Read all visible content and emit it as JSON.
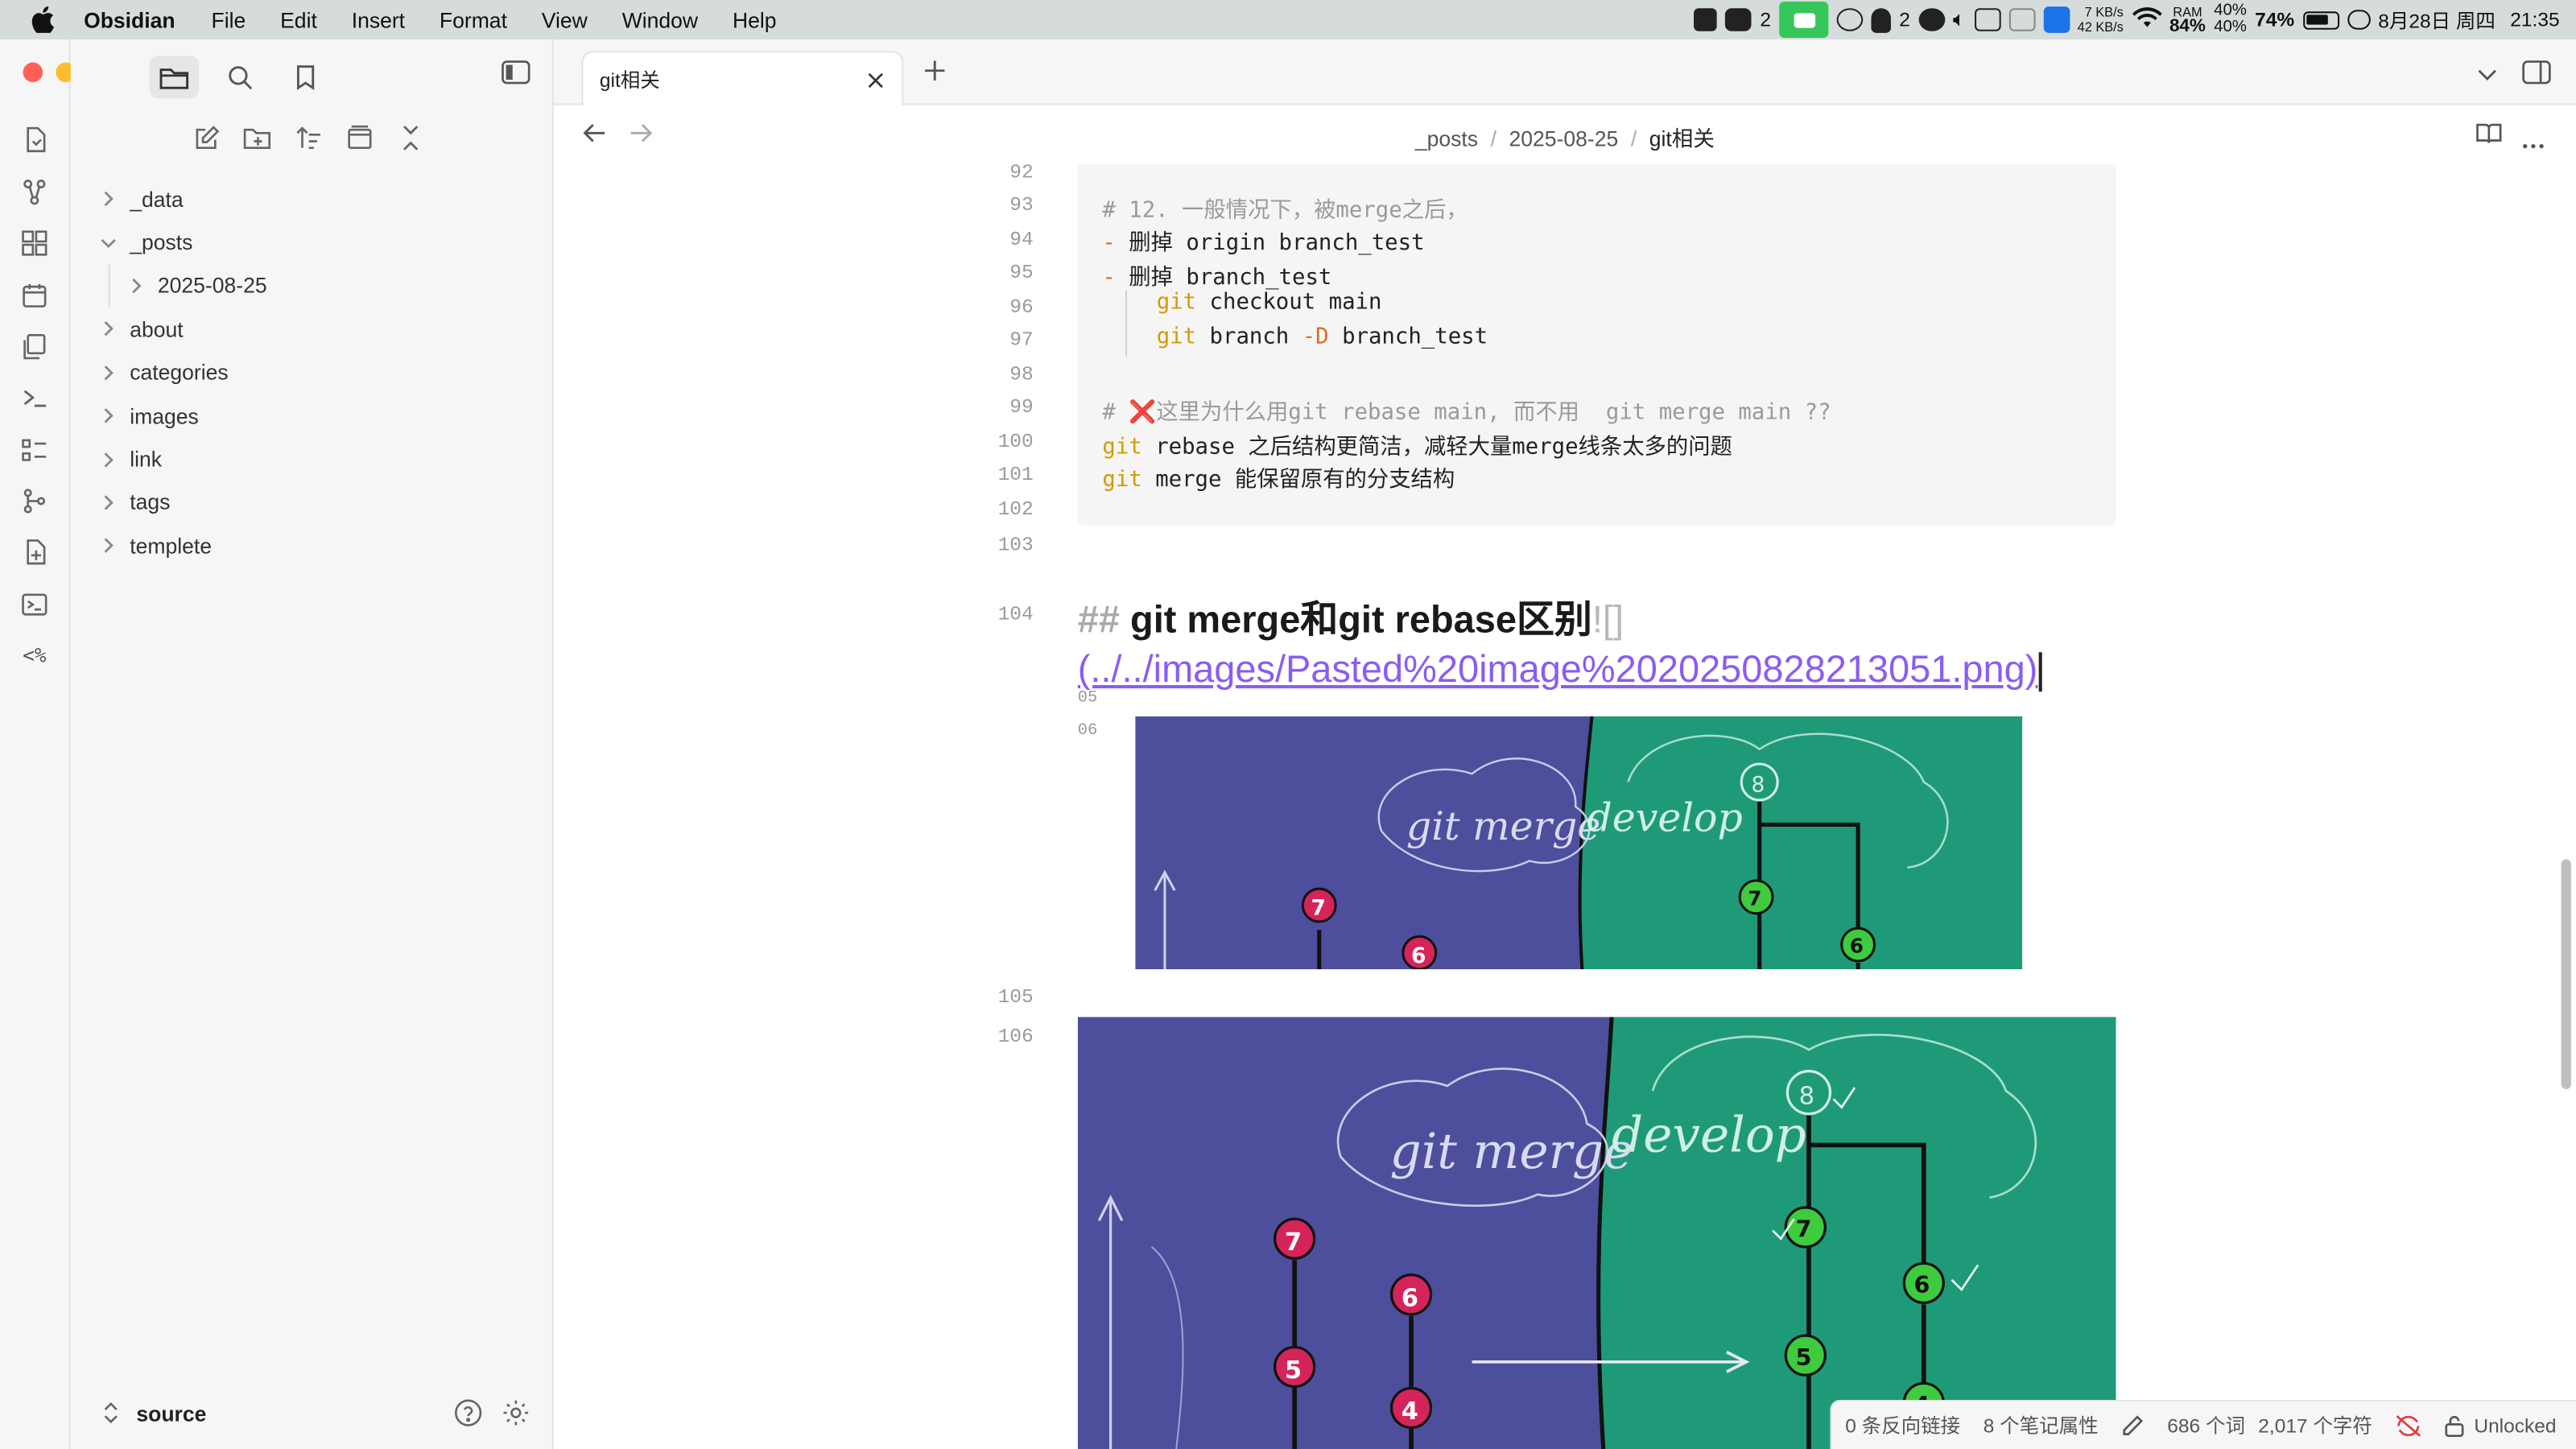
{
  "menubar": {
    "app": "Obsidian",
    "items": [
      "File",
      "Edit",
      "Insert",
      "Format",
      "View",
      "Window",
      "Help"
    ],
    "tray": {
      "badge1": "2",
      "badge2": "2",
      "net_up": "7 KB/s",
      "net_down": "42 KB/s",
      "ram_label": "RAM",
      "ram_pct": "84%",
      "cpu_top": "40%",
      "cpu_bottom": "40%",
      "battery": "74%",
      "date": "8月28日 周四",
      "time": "21:35"
    }
  },
  "sidebar": {
    "tree": [
      {
        "label": "_data",
        "expanded": false,
        "level": 0
      },
      {
        "label": "_posts",
        "expanded": true,
        "level": 0
      },
      {
        "label": "2025-08-25",
        "expanded": false,
        "level": 1
      },
      {
        "label": "about",
        "expanded": false,
        "level": 0
      },
      {
        "label": "categories",
        "expanded": false,
        "level": 0
      },
      {
        "label": "images",
        "expanded": false,
        "level": 0
      },
      {
        "label": "link",
        "expanded": false,
        "level": 0
      },
      {
        "label": "tags",
        "expanded": false,
        "level": 0
      },
      {
        "label": "templete",
        "expanded": false,
        "level": 0
      }
    ],
    "vault": "source"
  },
  "tab": {
    "title": "git相关"
  },
  "breadcrumb": {
    "p1": "_posts",
    "sep": "/",
    "p2": "2025-08-25",
    "p3": "git相关"
  },
  "editor": {
    "line_numbers": {
      "l92": "92",
      "l93": "93",
      "l94": "94",
      "l95": "95",
      "l96": "96",
      "l97": "97",
      "l98": "98",
      "l99": "99",
      "l100": "100",
      "l101": "101",
      "l102": "102",
      "l103": "103",
      "l104": "104",
      "l105a": "05",
      "l106a": "06",
      "l105": "105",
      "l106": "106"
    },
    "code": {
      "c93": "# 12. 一般情况下，被merge之后，",
      "c94_dash": "-",
      "c94": " 删掉 origin branch_test",
      "c95_dash": "-",
      "c95": " 删掉 branch_test",
      "c96_kw": "git",
      "c96": " checkout main",
      "c97_kw": "git",
      "c97_mid": " branch ",
      "c97_flag": "-D",
      "c97_end": " branch_test",
      "c99_hash": "# ",
      "c99_mark": "❌",
      "c99": "这里为什么用git rebase main, 而不用  git merge main ??",
      "c100_kw": "git",
      "c100": " rebase 之后结构更简洁，减轻大量merge线条太多的问题",
      "c101_kw": "git",
      "c101": " merge 能保留原有的分支结构"
    },
    "heading": {
      "marker": "##",
      "text": "git merge和git rebase区别",
      "bang": "!",
      "bracket": "[]",
      "link": "(../../images/Pasted%20image%2020250828213051.png)"
    },
    "image_labels": {
      "left": "git merge",
      "right": "develop",
      "nodes": [
        "8",
        "7",
        "6",
        "5",
        "4"
      ]
    }
  },
  "status": {
    "backlinks": "0 条反向链接",
    "properties": "8 个笔记属性",
    "words": "686 个词",
    "chars": "2,017 个字符",
    "lock": "Unlocked"
  },
  "colors": {
    "accent": "#8a5cf5",
    "keyword": "#d49b00",
    "img_left": "#4d4f9c",
    "img_right": "#1f9a78",
    "node_red": "#d5245a",
    "node_green": "#3ecb3e"
  }
}
